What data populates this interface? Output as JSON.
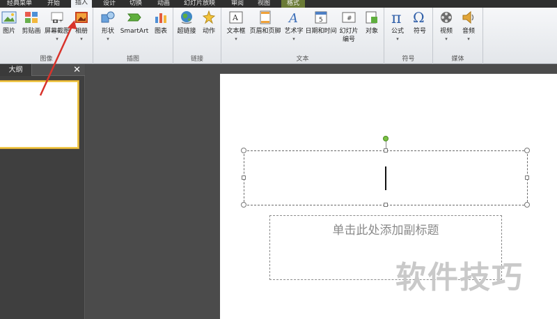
{
  "tabs": [
    {
      "label": "经典菜单"
    },
    {
      "label": "开始"
    },
    {
      "label": "插入"
    },
    {
      "label": "设计"
    },
    {
      "label": "切换"
    },
    {
      "label": "动画"
    },
    {
      "label": "幻灯片放映"
    },
    {
      "label": "审阅"
    },
    {
      "label": "视图"
    },
    {
      "label": "格式"
    }
  ],
  "ribbon": {
    "groups": {
      "image": {
        "label": "图像",
        "buttons": [
          "图片",
          "剪贴画",
          "屏幕截图",
          "相册"
        ]
      },
      "illustrations": {
        "label": "插图",
        "buttons": [
          "形状",
          "SmartArt",
          "图表"
        ]
      },
      "links": {
        "label": "链接",
        "buttons": [
          "超链接",
          "动作"
        ]
      },
      "text": {
        "label": "文本",
        "buttons": [
          "文本框",
          "页眉和页脚",
          "艺术字",
          "日期和时间",
          "幻灯片",
          "编号",
          "对象"
        ]
      },
      "symbols": {
        "label": "符号",
        "buttons": [
          "公式",
          "符号"
        ]
      },
      "media": {
        "label": "媒体",
        "buttons": [
          "视频",
          "音频"
        ]
      }
    },
    "dropdown_glyph": "▾"
  },
  "pane": {
    "tab_label": "大纲",
    "close_glyph": "✕"
  },
  "slide": {
    "subtitle_placeholder": "单击此处添加副标题"
  },
  "watermark": "软件技巧",
  "colors": {
    "accent": "#d9332b",
    "rotate_handle": "#7ac143",
    "thumb_border": "#f0c84a"
  }
}
